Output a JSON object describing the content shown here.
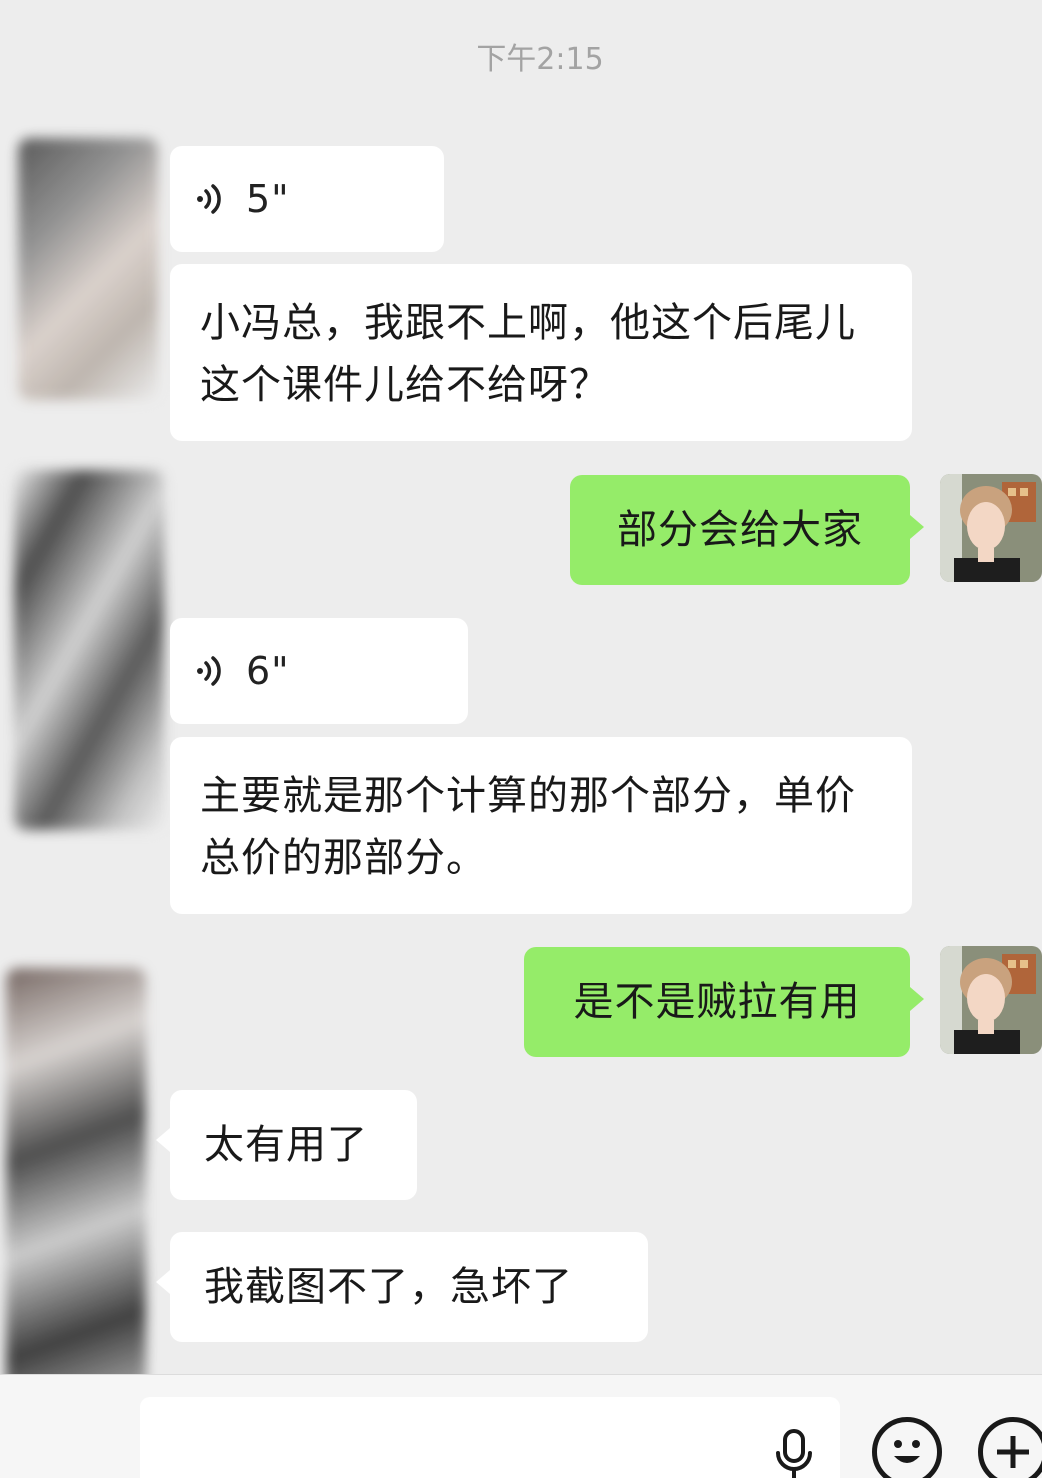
{
  "chat": {
    "time": "下午2:15",
    "messages": [
      {
        "side": "in",
        "type": "voice",
        "duration": "5\""
      },
      {
        "side": "in",
        "type": "text",
        "text": "小冯总，我跟不上啊，他这个后尾儿这个课件儿给不给呀？"
      },
      {
        "side": "out",
        "type": "text",
        "text": "部分会给大家"
      },
      {
        "side": "in",
        "type": "voice",
        "duration": "6\""
      },
      {
        "side": "in",
        "type": "text",
        "text": "主要就是那个计算的那个部分，单价总价的那部分。"
      },
      {
        "side": "out",
        "type": "text",
        "text": "是不是贼拉有用"
      },
      {
        "side": "in",
        "type": "text",
        "text": "太有用了"
      },
      {
        "side": "in",
        "type": "text",
        "text": "我截图不了，急坏了"
      }
    ]
  },
  "input_bar": {
    "icons": [
      "voice-input-icon",
      "emoji-icon",
      "plus-icon"
    ]
  },
  "colors": {
    "background": "#ededed",
    "incoming_bubble": "#ffffff",
    "outgoing_bubble": "#95ec69",
    "timestamp": "#a3a3a3"
  }
}
